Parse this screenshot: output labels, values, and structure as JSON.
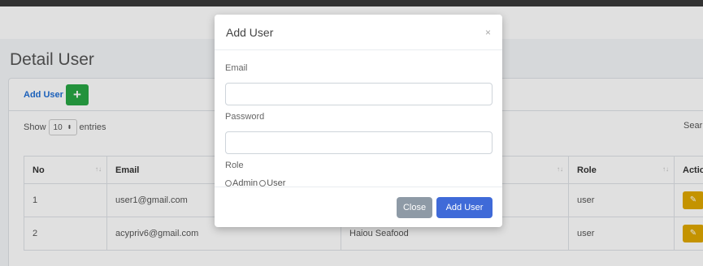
{
  "page": {
    "heading": "Detail User",
    "add_user_link": "Add User",
    "plus_symbol": "+",
    "show_label": "Show",
    "entries_value": "10",
    "entries_label": "entries",
    "search_label": "Sear"
  },
  "table": {
    "headers": [
      "No",
      "Email",
      "",
      "Role",
      "Actio"
    ],
    "rows": [
      {
        "no": "1",
        "email": "user1@gmail.com",
        "company": "",
        "role": "user"
      },
      {
        "no": "2",
        "email": "acypriv6@gmail.com",
        "company": "Haiou Seafood",
        "role": "user"
      }
    ]
  },
  "modal": {
    "title": "Add User",
    "close_symbol": "×",
    "email_label": "Email",
    "email_value": "",
    "password_label": "Password",
    "password_value": "",
    "role_label": "Role",
    "role_options": [
      "Admin",
      "User"
    ],
    "close_button": "Close",
    "submit_button": "Add User"
  },
  "colors": {
    "primary": "#3f6ad8",
    "secondary": "#8e9aa6",
    "success": "#28a745",
    "warning": "#e0a800",
    "link": "#1f6ed4"
  },
  "icons": {
    "sort": "sort-icon",
    "edit": "edit-icon",
    "plus": "plus-icon",
    "close": "close-icon"
  }
}
